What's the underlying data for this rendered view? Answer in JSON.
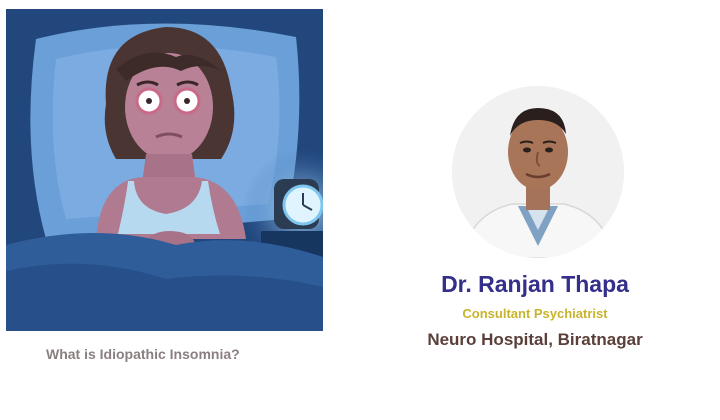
{
  "article": {
    "caption": "What is Idiopathic Insomnia?",
    "image_subject": "woman awake in bed at night beside a glowing alarm clock"
  },
  "doctor": {
    "name": "Dr. Ranjan Thapa",
    "title": "Consultant Psychiatrist",
    "hospital": "Neuro Hospital, Biratnagar"
  },
  "colors": {
    "name": "#332f8a",
    "title": "#c8b42c",
    "hospital": "#5b403a",
    "caption": "#8a7f80",
    "night_blue": "#1e3f72"
  }
}
